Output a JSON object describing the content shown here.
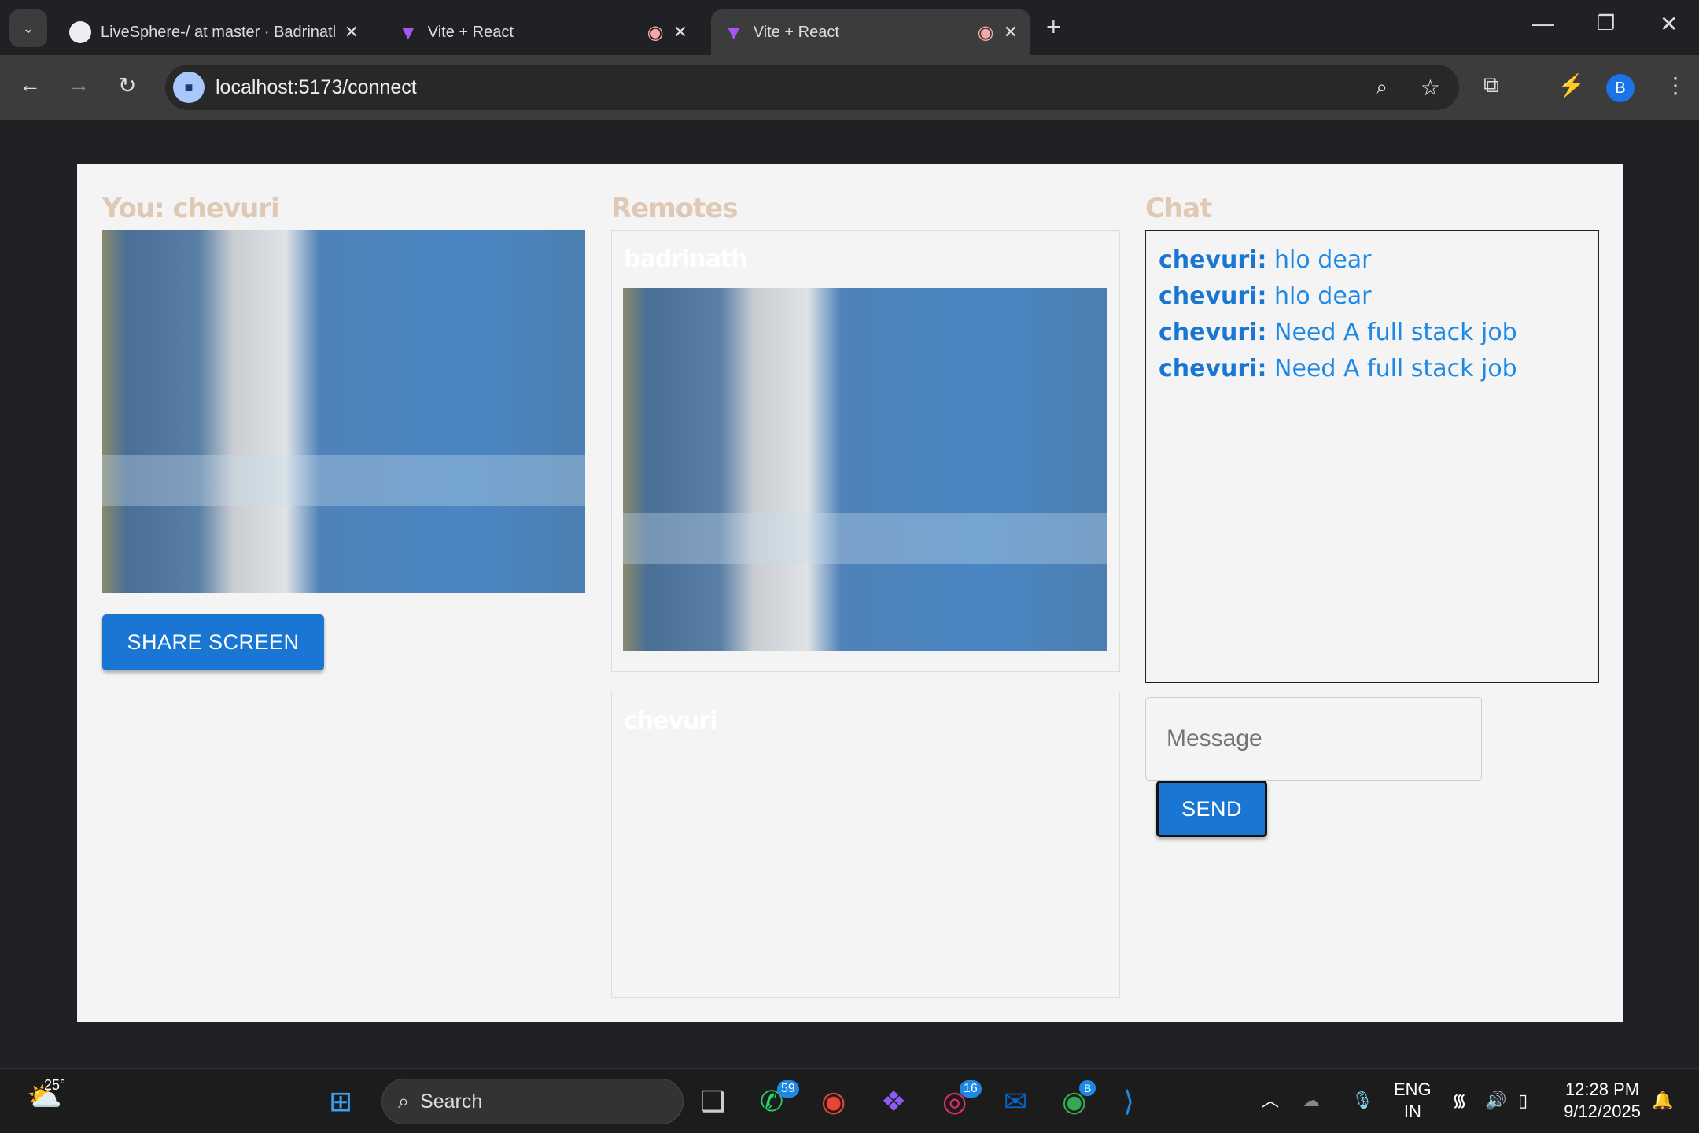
{
  "browser": {
    "tabs": [
      {
        "title": "LiveSphere-/ at master · Badrinath"
      },
      {
        "title": "Vite + React"
      },
      {
        "title": "Vite + React"
      }
    ],
    "url": "localhost:5173/connect",
    "profile_initial": "B"
  },
  "page": {
    "local_heading": "You: chevuri",
    "share_label": "SHARE SCREEN",
    "remotes_heading": "Remotes",
    "remotes": [
      {
        "name": "badrinath"
      },
      {
        "name": "chevuri"
      }
    ],
    "chat_heading": "Chat",
    "messages": [
      {
        "user": "chevuri:",
        "text": "hlo dear"
      },
      {
        "user": "chevuri:",
        "text": "hlo dear"
      },
      {
        "user": "chevuri:",
        "text": "Need A full stack job"
      },
      {
        "user": "chevuri:",
        "text": "Need A full stack job"
      }
    ],
    "message_placeholder": "Message",
    "send_label": "SEND"
  },
  "taskbar": {
    "weather": "25°",
    "search": "Search",
    "whatsapp_badge": "59",
    "instagram_badge": "16",
    "chrome_badge": "B",
    "lang": "ENG",
    "region": "IN",
    "time": "12:28 PM",
    "date": "9/12/2025"
  }
}
